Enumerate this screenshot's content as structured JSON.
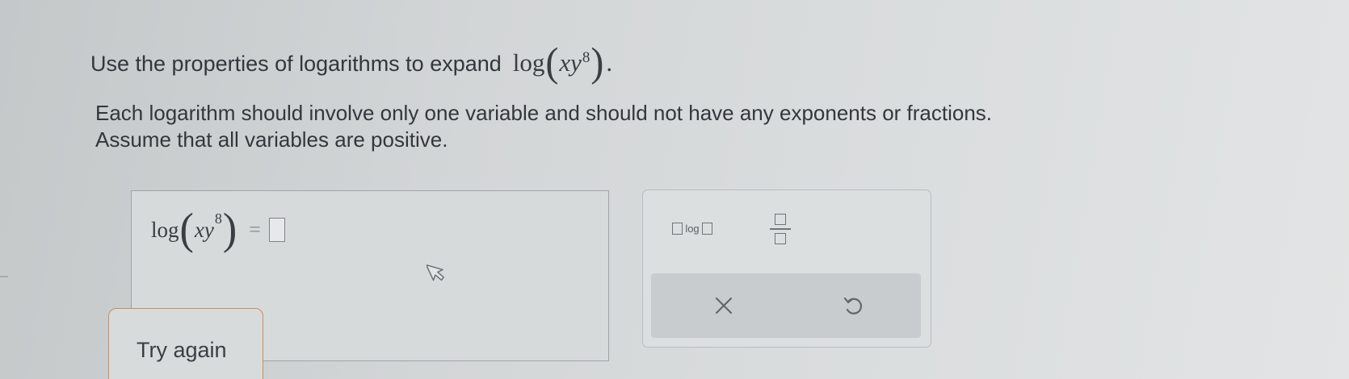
{
  "question": {
    "prompt": "Use the properties of logarithms to expand",
    "expression": {
      "fn": "log",
      "var_x": "x",
      "var_y": "y",
      "exponent": "8",
      "terminal": "."
    },
    "instructions_line1": "Each logarithm should involve only one variable and should not have any exponents or fractions.",
    "instructions_line2": "Assume that all variables are positive."
  },
  "answer": {
    "fn": "log",
    "var_x": "x",
    "var_y": "y",
    "exponent": "8",
    "equals": "=",
    "input_value": ""
  },
  "buttons": {
    "try_again": "Try again"
  },
  "palette": {
    "log_button_label": "log",
    "fraction_button_icon": "fraction-template-icon",
    "clear_icon": "close-icon",
    "undo_icon": "undo-icon"
  },
  "colors": {
    "try_again_border": "#c98f5e",
    "action_bar": "#c8ccce"
  }
}
